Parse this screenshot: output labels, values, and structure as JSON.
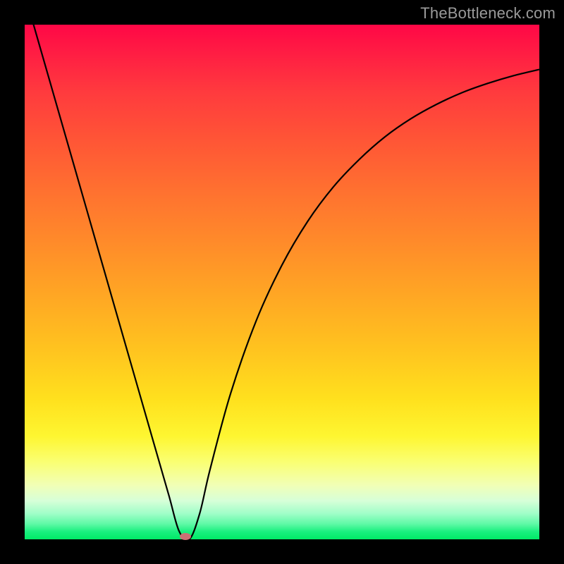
{
  "watermark": "TheBottleneck.com",
  "chart_data": {
    "type": "line",
    "title": "",
    "xlabel": "",
    "ylabel": "",
    "xlim": [
      0,
      100
    ],
    "ylim": [
      0,
      100
    ],
    "grid": false,
    "series": [
      {
        "name": "curve",
        "x": [
          0,
          5,
          10,
          15,
          20,
          25,
          28,
          30,
          32,
          34,
          36,
          40,
          45,
          50,
          55,
          60,
          65,
          70,
          75,
          80,
          85,
          90,
          95,
          100
        ],
        "y": [
          106,
          88.6,
          71.2,
          53.8,
          36.4,
          19.0,
          8.6,
          1.6,
          0.0,
          5.0,
          13.5,
          28.3,
          42.5,
          53.3,
          61.8,
          68.5,
          73.8,
          78.2,
          81.7,
          84.5,
          86.8,
          88.6,
          90.1,
          91.3
        ]
      }
    ],
    "marker": {
      "x": 31.3,
      "y": 0.5
    },
    "background_gradient_stops": [
      {
        "pct": 0,
        "color": "#ff0746"
      },
      {
        "pct": 50,
        "color": "#ff9e27"
      },
      {
        "pct": 80,
        "color": "#fef631"
      },
      {
        "pct": 100,
        "color": "#00ea66"
      }
    ]
  }
}
